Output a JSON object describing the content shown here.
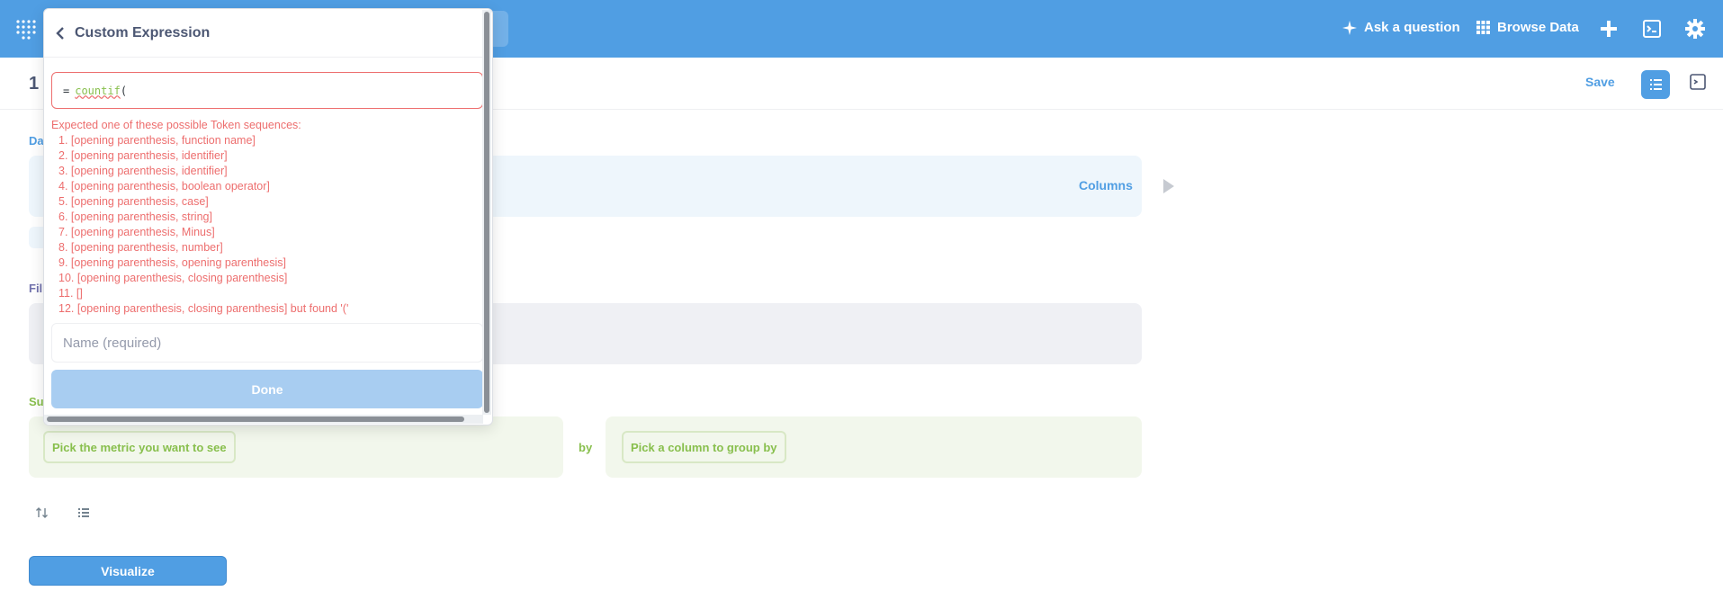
{
  "colors": {
    "brand": "#509ee3",
    "error": "#ed6e6e",
    "summarize": "#88bf4d"
  },
  "nav": {
    "ask_question": "Ask a question",
    "browse_data": "Browse Data",
    "icons": [
      "metabase-logo-icon",
      "sparkle-icon",
      "grid-icon",
      "plus-icon",
      "sql-icon",
      "gear-icon"
    ]
  },
  "query": {
    "title_fragment": "1",
    "save_label": "Save",
    "data_label_fragment": "Da",
    "filter_label_fragment": "Fil",
    "summarize_label_fragment": "Su",
    "columns_label": "Columns",
    "metric_placeholder": "Pick the metric you want to see",
    "by_label": "by",
    "group_placeholder": "Pick a column to group by",
    "visualize_label": "Visualize"
  },
  "popover": {
    "title": "Custom Expression",
    "expression_prefix": "=",
    "expression_func": "countif",
    "expression_suffix": "(",
    "error_heading": "Expected one of these possible Token sequences:",
    "errors": [
      "1. [opening parenthesis, function name]",
      "2. [opening parenthesis, identifier]",
      "3. [opening parenthesis, identifier]",
      "4. [opening parenthesis, boolean operator]",
      "5. [opening parenthesis, case]",
      "6. [opening parenthesis, string]",
      "7. [opening parenthesis, Minus]",
      "8. [opening parenthesis, number]",
      "9. [opening parenthesis, opening parenthesis]",
      "10. [opening parenthesis, closing parenthesis]",
      "11. []",
      "12. [opening parenthesis, closing parenthesis] but found  '('"
    ],
    "name_placeholder": "Name (required)",
    "done_label": "Done"
  }
}
